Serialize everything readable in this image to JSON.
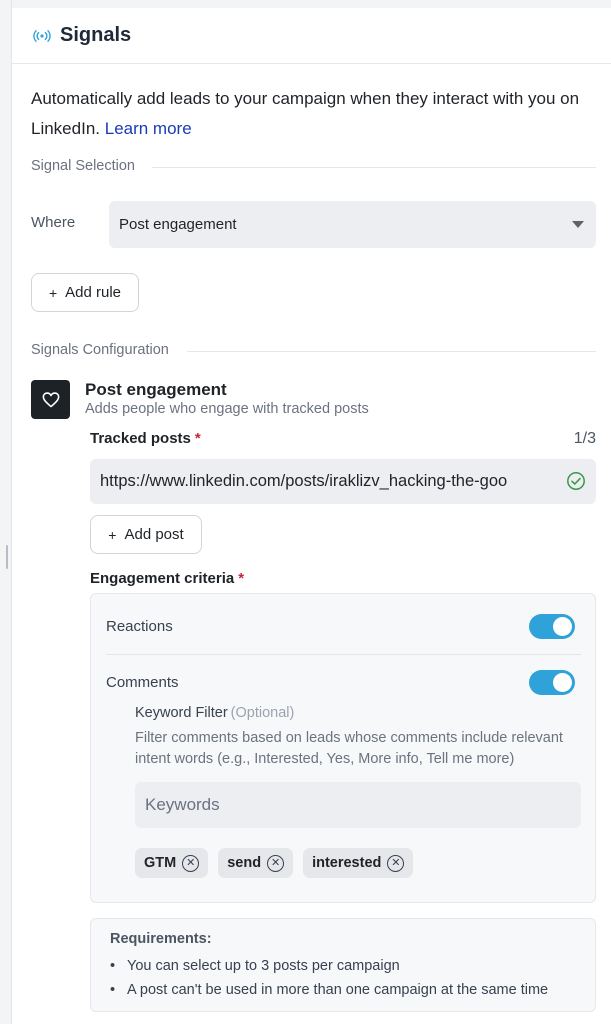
{
  "header": {
    "title": "Signals",
    "icon": "broadcast-icon"
  },
  "intro": {
    "text": "Automatically add leads to your campaign when they interact with you on LinkedIn.",
    "link": "Learn more"
  },
  "signal_selection": {
    "section_label": "Signal Selection",
    "where_label": "Where",
    "where_value": "Post engagement",
    "add_rule_label": "Add rule"
  },
  "signals_configuration": {
    "section_label": "Signals Configuration",
    "card_title": "Post engagement",
    "card_subtitle": "Adds people who engage with tracked posts",
    "tracked_posts_label": "Tracked posts",
    "tracked_posts_count": "1/3",
    "tracked_post_url": "https://www.linkedin.com/posts/iraklizv_hacking-the-goo",
    "add_post_label": "Add post",
    "engagement_label": "Engagement criteria",
    "reactions_label": "Reactions",
    "reactions_enabled": true,
    "comments_label": "Comments",
    "comments_enabled": true,
    "keyword_filter_label": "Keyword Filter",
    "keyword_optional": "(Optional)",
    "keyword_description": "Filter comments based on leads whose comments include relevant intent words (e.g., Interested, Yes, More info, Tell me more)",
    "keyword_placeholder": "Keywords",
    "keywords": [
      "GTM",
      "send",
      "interested"
    ]
  },
  "requirements": {
    "title": "Requirements:",
    "items": [
      "You can select up to 3 posts per campaign",
      "A post can't be used in more than one campaign at the same time"
    ]
  },
  "colors": {
    "accent_toggle": "#2fa3d9",
    "link": "#1a3bb5",
    "required": "#c0263b",
    "valid": "#3a9a4a"
  }
}
